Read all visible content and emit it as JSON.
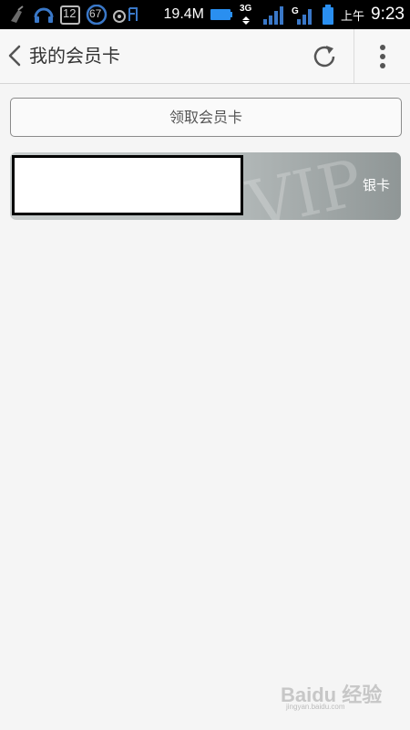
{
  "status_bar": {
    "notif_count_1": "12",
    "notif_count_2": "67",
    "speed": "19.4M",
    "network_type": "3G",
    "ampm": "上午",
    "time": "9:23"
  },
  "app_bar": {
    "title": "我的会员卡"
  },
  "get_card_button": {
    "label": "领取会员卡"
  },
  "member_card": {
    "level": "银卡",
    "watermark": "VIP"
  },
  "watermark": {
    "brand": "Baidu 经验",
    "url": "jingyan.baidu.com"
  },
  "colors": {
    "status_bar_bg": "#000000",
    "app_bg": "#f5f5f5",
    "card_silver": "#b9bfbf"
  }
}
